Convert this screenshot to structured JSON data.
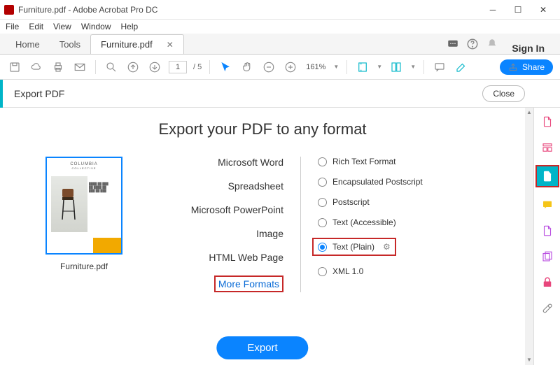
{
  "window": {
    "title": "Furniture.pdf - Adobe Acrobat Pro DC"
  },
  "menubar": [
    "File",
    "Edit",
    "View",
    "Window",
    "Help"
  ],
  "tabs": {
    "home": "Home",
    "tools": "Tools",
    "doc": "Furniture.pdf",
    "signIn": "Sign In"
  },
  "toolbar": {
    "page": "1",
    "totalPages": "/ 5",
    "zoom": "161%",
    "share": "Share"
  },
  "panel": {
    "name": "Export PDF",
    "close": "Close"
  },
  "export": {
    "heading": "Export your PDF to any format",
    "thumbTitle": "COLUMBIA",
    "thumbSub": "COLLECTIVE",
    "fileName": "Furniture.pdf",
    "formats": [
      "Microsoft Word",
      "Spreadsheet",
      "Microsoft PowerPoint",
      "Image",
      "HTML Web Page",
      "More Formats"
    ],
    "options": [
      "Rich Text Format",
      "Encapsulated Postscript",
      "Postscript",
      "Text (Accessible)",
      "Text (Plain)",
      "XML 1.0"
    ],
    "button": "Export"
  }
}
